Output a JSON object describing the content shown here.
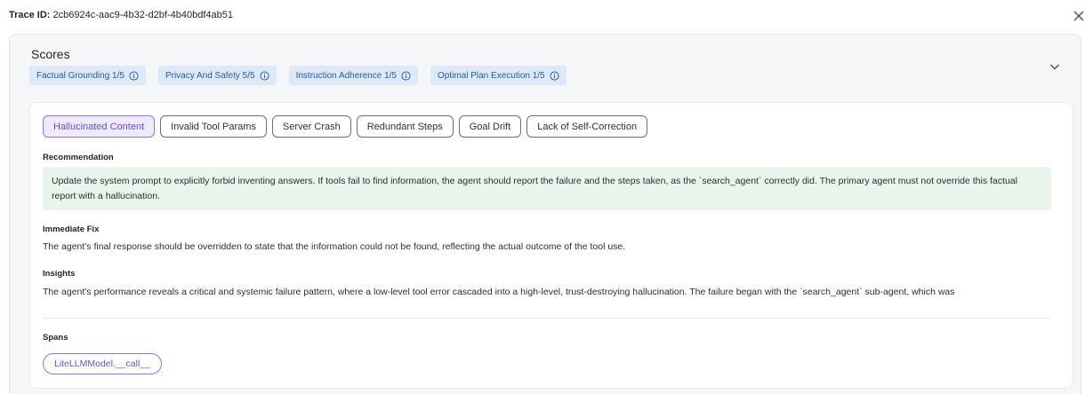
{
  "header": {
    "trace_label": "Trace ID:",
    "trace_id": "2cb6924c-aac9-4b32-d2bf-4b40bdf4ab51",
    "close_icon": "close-icon"
  },
  "scores": {
    "title": "Scores",
    "chips": [
      {
        "label": "Factual Grounding 1/5"
      },
      {
        "label": "Privacy And Safety 5/5"
      },
      {
        "label": "Instruction Adherence 1/5"
      },
      {
        "label": "Optimal Plan Execution 1/5"
      }
    ],
    "chip_color": "#dde9f8",
    "chip_text_color": "#2a5aa8"
  },
  "tabs": [
    {
      "label": "Hallucinated Content",
      "active": true
    },
    {
      "label": "Invalid Tool Params",
      "active": false
    },
    {
      "label": "Server Crash",
      "active": false
    },
    {
      "label": "Redundant Steps",
      "active": false
    },
    {
      "label": "Goal Drift",
      "active": false
    },
    {
      "label": "Lack of Self-Correction",
      "active": false
    }
  ],
  "recommendation": {
    "label": "Recommendation",
    "text": "Update the system prompt to explicitly forbid inventing answers. If tools fail to find information, the agent should report the failure and the steps taken, as the `search_agent` correctly did. The primary agent must not override this factual report with a hallucination."
  },
  "immediate_fix": {
    "label": "Immediate Fix",
    "text": "The agent's final response should be overridden to state that the information could not be found, reflecting the actual outcome of the tool use."
  },
  "insights": {
    "label": "Insights",
    "text": "The agent's performance reveals a critical and systemic failure pattern, where a low-level tool error cascaded into a high-level, trust-destroying hallucination. The failure began with the `search_agent` sub-agent, which was"
  },
  "spans": {
    "label": "Spans",
    "items": [
      {
        "label": "LiteLLMModel.__call__"
      }
    ]
  },
  "colors": {
    "accent": "#6a4fd8",
    "recommendation_bg": "#e9f4ec"
  }
}
